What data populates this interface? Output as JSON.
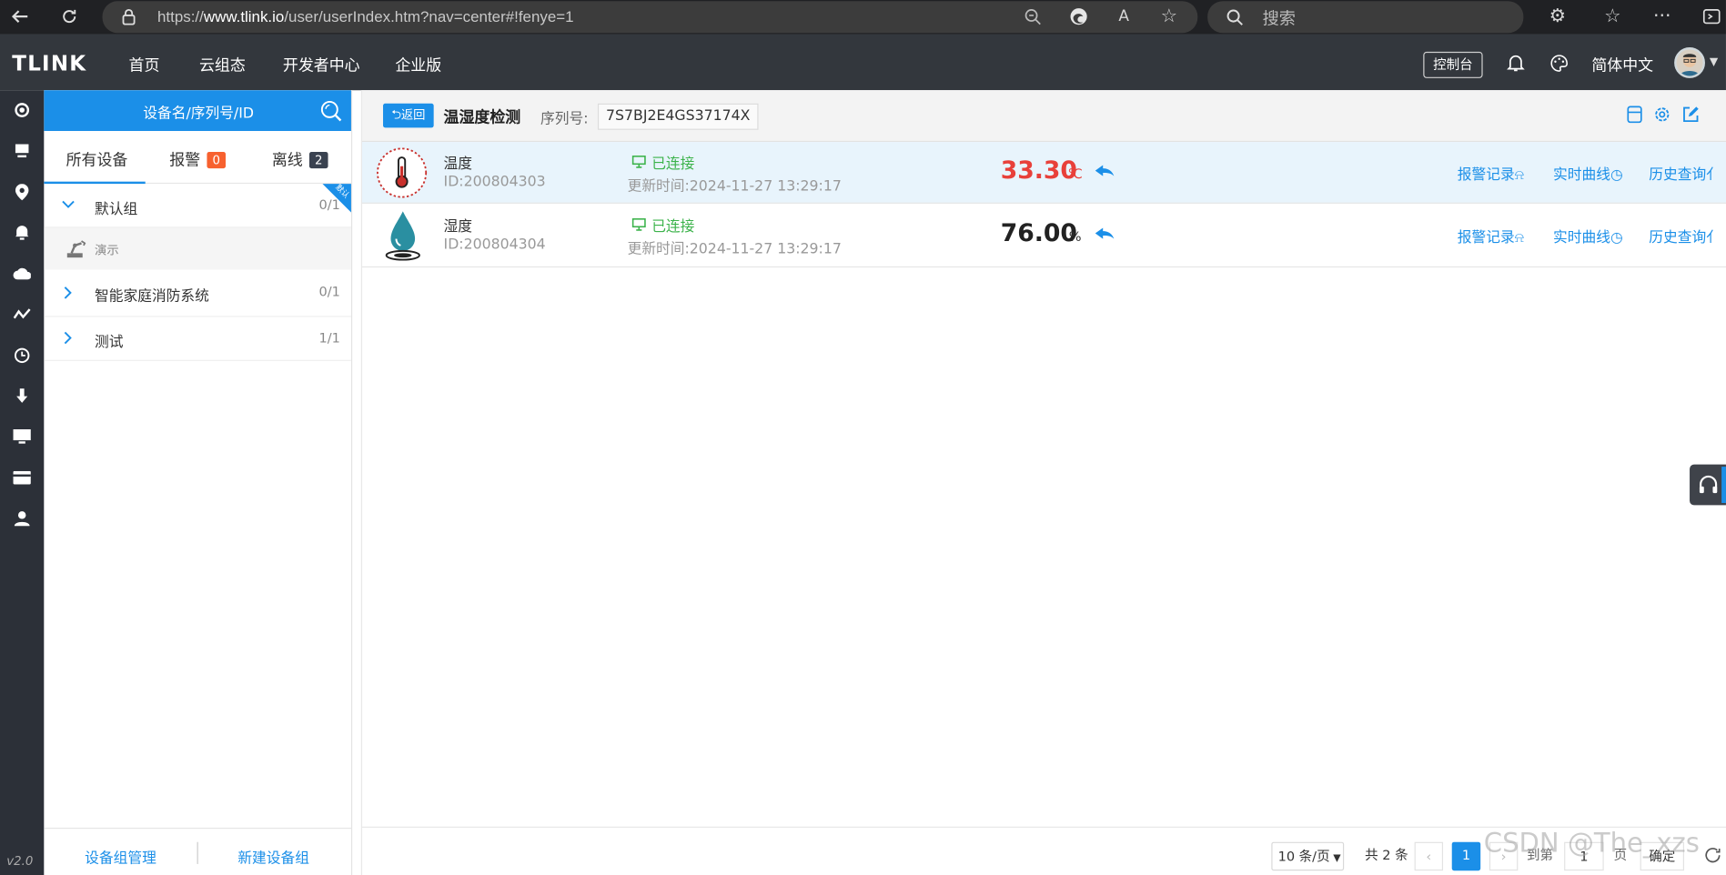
{
  "browser": {
    "url_prefix": "https://",
    "url_host": "www.tlink.io",
    "url_path": "/user/userIndex.htm?nav=center#!fenye=1",
    "search_placeholder": "搜索"
  },
  "topnav": {
    "logo": "TLINK",
    "items": [
      "首页",
      "云组态",
      "开发者中心",
      "企业版"
    ],
    "console": "控制台",
    "language": "简体中文"
  },
  "sidebar": {
    "version": "v2.0"
  },
  "devices_panel": {
    "search_placeholder": "设备名/序列号/ID",
    "tabs": [
      {
        "label": "所有设备"
      },
      {
        "label": "报警",
        "badge": "0",
        "badge_color": "#f7612f"
      },
      {
        "label": "离线",
        "badge": "2",
        "badge_color": "#3a4250"
      }
    ],
    "corner_tag": "默认",
    "groups": [
      {
        "name": "默认组",
        "count": "0/1",
        "expanded": true
      },
      {
        "name": "智能家庭消防系统",
        "count": "0/1",
        "expanded": false
      },
      {
        "name": "测试",
        "count": "1/1",
        "expanded": false
      }
    ],
    "devices": [
      {
        "name": "演示"
      }
    ],
    "footer": {
      "manage": "设备组管理",
      "new_group": "新建设备组"
    }
  },
  "main": {
    "back": "返回",
    "device_title": "温湿度检测",
    "serial_label": "序列号:",
    "serial": "7S7BJ2E4GS37174X",
    "sensors": [
      {
        "name": "温度",
        "id": "ID:200804303",
        "status": "已连接",
        "updated": "更新时间:2024-11-27 13:29:17",
        "value": "33.30",
        "unit": "℃",
        "value_color": "#e8403a",
        "icon": "thermometer-icon"
      },
      {
        "name": "湿度",
        "id": "ID:200804304",
        "status": "已连接",
        "updated": "更新时间:2024-11-27 13:29:17",
        "value": "76.00",
        "unit": "%",
        "value_color": "#222222",
        "icon": "water-drop-icon"
      }
    ],
    "links": {
      "alarm": "报警记录",
      "realtime": "实时曲线",
      "history": "历史查询"
    }
  },
  "pagination": {
    "page_size": "10 条/页",
    "total": "共 2 条",
    "current": "1",
    "goto_label": "到第",
    "goto_value": "1",
    "page_suffix": "页",
    "confirm": "确定"
  },
  "watermark": "CSDN @The_xzs"
}
